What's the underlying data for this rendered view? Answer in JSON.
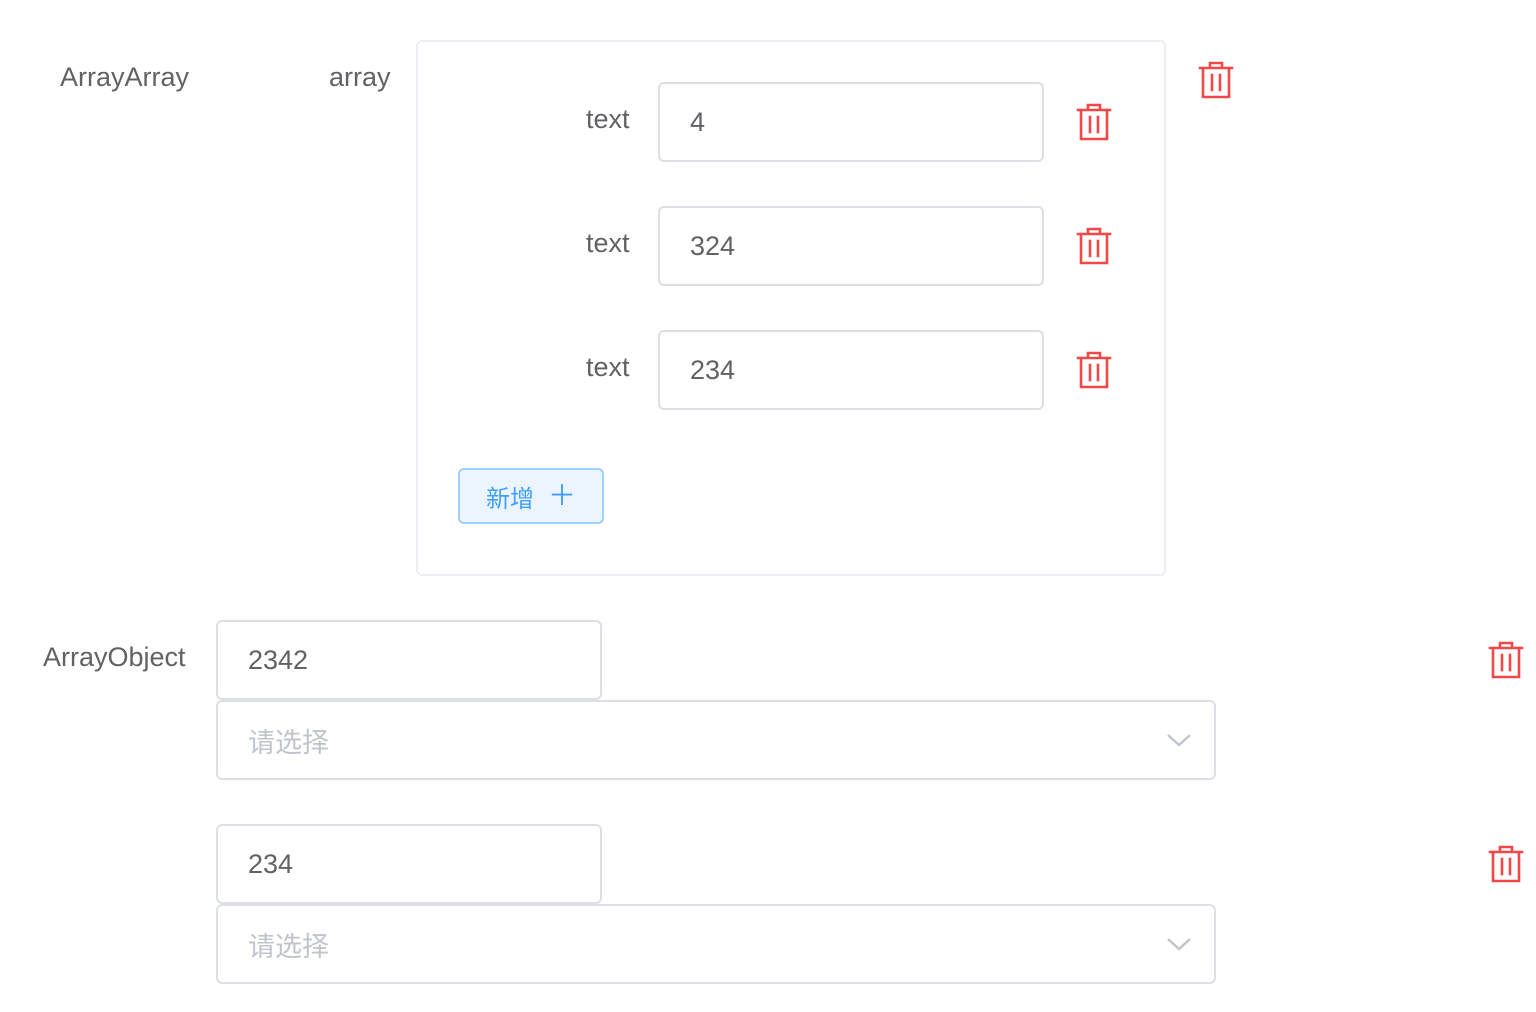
{
  "array_array": {
    "label": "ArrayArray",
    "sub_label": "array",
    "items": [
      {
        "label": "text",
        "value": "4"
      },
      {
        "label": "text",
        "value": "324"
      },
      {
        "label": "text",
        "value": "234"
      }
    ],
    "add_button_label": "新增",
    "add_button_icon": "＋"
  },
  "array_object": {
    "label": "ArrayObject",
    "items": [
      {
        "value": "2342",
        "select_placeholder": "请选择"
      },
      {
        "value": "234",
        "select_placeholder": "请选择"
      }
    ]
  },
  "icons": {
    "delete": "trash-icon",
    "dropdown": "chevron-down-icon",
    "add": "plus-icon"
  },
  "colors": {
    "danger": "#f04848",
    "primary": "#409eff",
    "border": "#dcdfe6",
    "text": "#606266",
    "placeholder": "#c0c4cc"
  }
}
